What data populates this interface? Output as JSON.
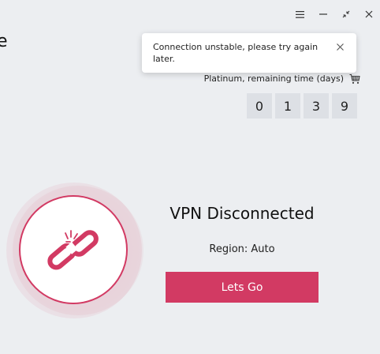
{
  "window": {
    "title_fragment": "e",
    "controls": [
      "menu-icon",
      "minimize-icon",
      "restore-icon",
      "close-icon"
    ]
  },
  "toast": {
    "message": "Connection unstable, please try again later."
  },
  "plan": {
    "label": "Platinum, remaining time (days)",
    "digits": [
      "0",
      "1",
      "3",
      "9"
    ]
  },
  "status": {
    "title": "VPN Disconnected",
    "region": "Region: Auto",
    "button_label": "Lets Go",
    "icon": "broken-link-icon"
  },
  "colors": {
    "accent": "#d23a63",
    "background": "#eceef1"
  }
}
